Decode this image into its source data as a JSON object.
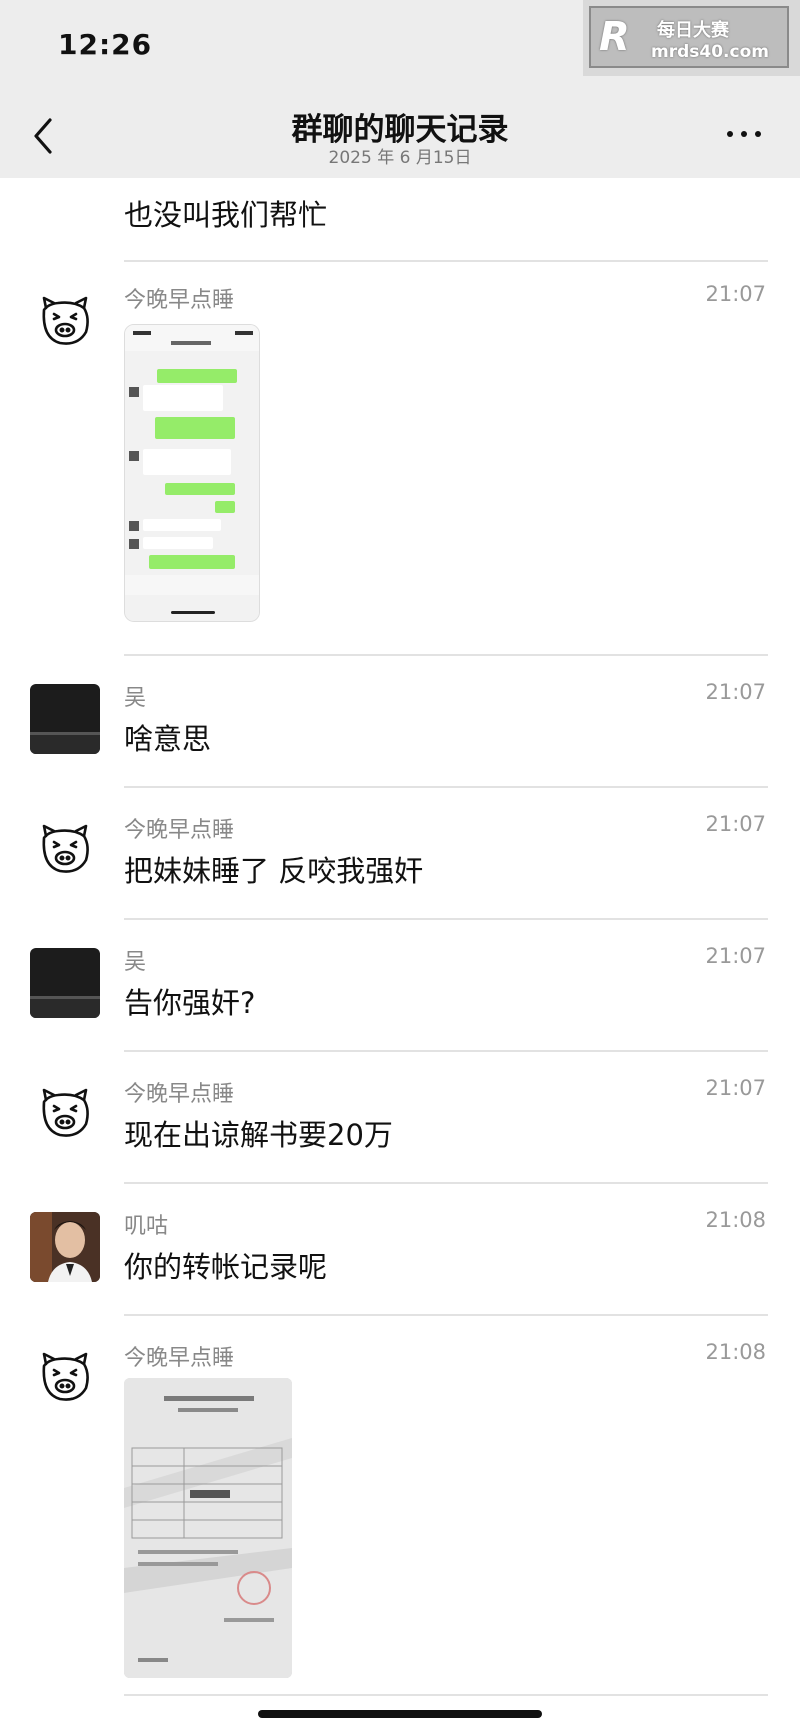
{
  "status_bar": {
    "time": "12:26"
  },
  "watermark": {
    "logo": "R",
    "title": "每日大赛",
    "site": "mrds40.com"
  },
  "header": {
    "title": "群聊的聊天记录",
    "date": "2025 年 6 月15日",
    "back_icon": "chevron-left-icon",
    "more_icon": "more-dots-icon"
  },
  "messages": [
    {
      "sender": "",
      "time": "",
      "text": "也没叫我们帮忙"
    },
    {
      "sender": "今晚早点睡",
      "time": "21:07",
      "type": "image",
      "image": "chat-screenshot"
    },
    {
      "sender": "吴",
      "time": "21:07",
      "text": "啥意思"
    },
    {
      "sender": "今晚早点睡",
      "time": "21:07",
      "text": "把妹妹睡了 反咬我强奸"
    },
    {
      "sender": "吴",
      "time": "21:07",
      "text": "告你强奸?"
    },
    {
      "sender": "今晚早点睡",
      "time": "21:07",
      "text": "现在出谅解书要20万"
    },
    {
      "sender": "叽咕",
      "time": "21:08",
      "text": "你的转帐记录呢"
    },
    {
      "sender": "今晚早点睡",
      "time": "21:08",
      "type": "image",
      "image": "document-photo"
    }
  ]
}
